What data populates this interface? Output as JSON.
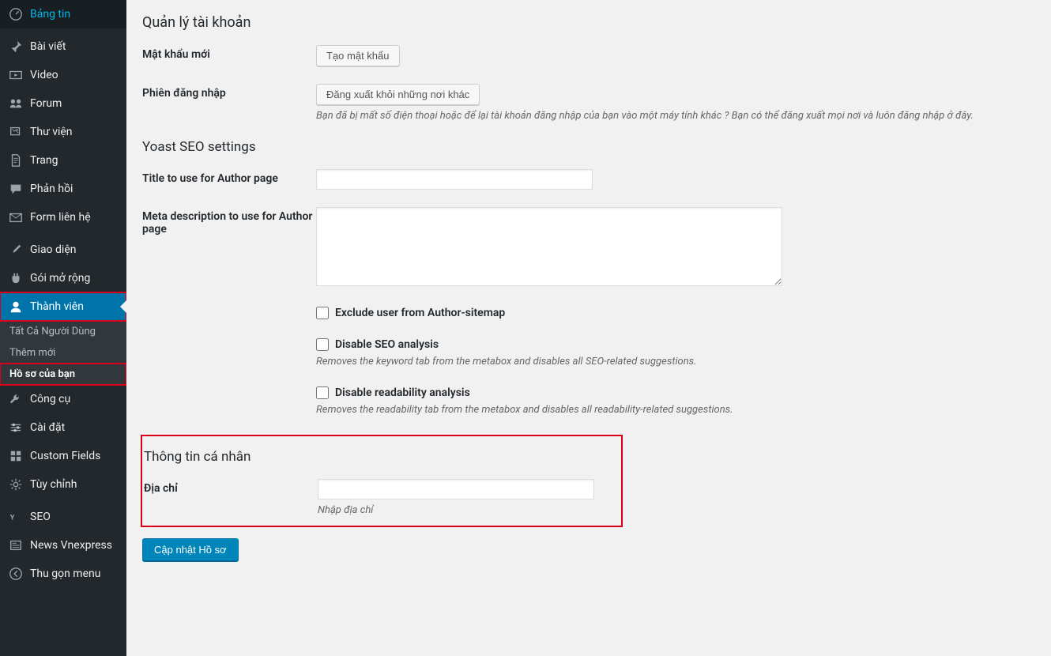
{
  "sidebar": {
    "items": [
      {
        "icon": "dashboard",
        "label": "Bảng tin"
      },
      {
        "icon": "pin",
        "label": "Bài viết"
      },
      {
        "icon": "video",
        "label": "Video"
      },
      {
        "icon": "forum",
        "label": "Forum"
      },
      {
        "icon": "library",
        "label": "Thư viện"
      },
      {
        "icon": "page",
        "label": "Trang"
      },
      {
        "icon": "comment",
        "label": "Phản hồi"
      },
      {
        "icon": "mail",
        "label": "Form liên hệ"
      }
    ],
    "items2": [
      {
        "icon": "brush",
        "label": "Giao diện"
      },
      {
        "icon": "plugin",
        "label": "Gói mở rộng"
      },
      {
        "icon": "user",
        "label": "Thành viên",
        "current": true
      }
    ],
    "subs": [
      {
        "label": "Tất Cả Người Dùng"
      },
      {
        "label": "Thêm mới"
      },
      {
        "label": "Hồ sơ của bạn",
        "active": true
      }
    ],
    "items3": [
      {
        "icon": "wrench",
        "label": "Công cụ"
      },
      {
        "icon": "settings",
        "label": "Cài đặt"
      },
      {
        "icon": "grid",
        "label": "Custom Fields"
      },
      {
        "icon": "gear",
        "label": "Tùy chỉnh"
      }
    ],
    "items4": [
      {
        "icon": "seo",
        "label": "SEO"
      },
      {
        "icon": "news",
        "label": "News Vnexpress"
      },
      {
        "icon": "collapse",
        "label": "Thu gọn menu"
      }
    ]
  },
  "content": {
    "account_heading": "Quản lý tài khoản",
    "password_label": "Mật khẩu mới",
    "password_button": "Tạo mật khẩu",
    "session_label": "Phiên đăng nhập",
    "session_button": "Đăng xuất khỏi những nơi khác",
    "session_desc": "Bạn đã bị mất số điện thoại hoặc để lại tài khoản đăng nhập của bạn vào một máy tính khác ? Bạn có thể đăng xuất mọi nơi và luôn đăng nhập ở đây.",
    "yoast_heading": "Yoast SEO settings",
    "author_title_label": "Title to use for Author page",
    "author_meta_label": "Meta description to use for Author page",
    "exclude_label": "Exclude user from Author-sitemap",
    "disable_seo_label": "Disable SEO analysis",
    "disable_seo_desc": "Removes the keyword tab from the metabox and disables all SEO-related suggestions.",
    "disable_read_label": "Disable readability analysis",
    "disable_read_desc": "Removes the readability tab from the metabox and disables all readability-related suggestions.",
    "personal_heading": "Thông tin cá nhân",
    "address_label": "Địa chỉ",
    "address_desc": "Nhập địa chỉ",
    "submit_button": "Cập nhật Hồ sơ"
  }
}
